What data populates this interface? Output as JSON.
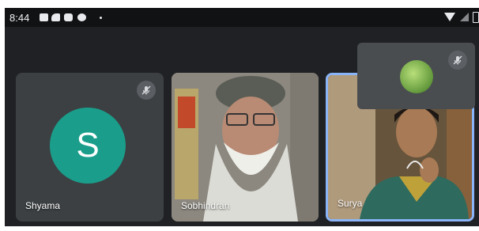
{
  "status_bar": {
    "time": "8:44"
  },
  "participants": [
    {
      "name": "Shyama",
      "avatar_letter": "S",
      "avatar_color": "#1a9e8b",
      "muted": true
    },
    {
      "name": "Sobhindran",
      "muted": false
    },
    {
      "name": "Surya",
      "muted": false,
      "active_speaker": true,
      "highlight_color": "#8ab4f8"
    }
  ],
  "self_view": {
    "muted": true
  },
  "icons": [
    "gallery-icon",
    "cast-icon",
    "youtube-icon",
    "notification-icon",
    "wifi-icon",
    "signal-icon",
    "battery-icon",
    "mic-off-icon"
  ]
}
